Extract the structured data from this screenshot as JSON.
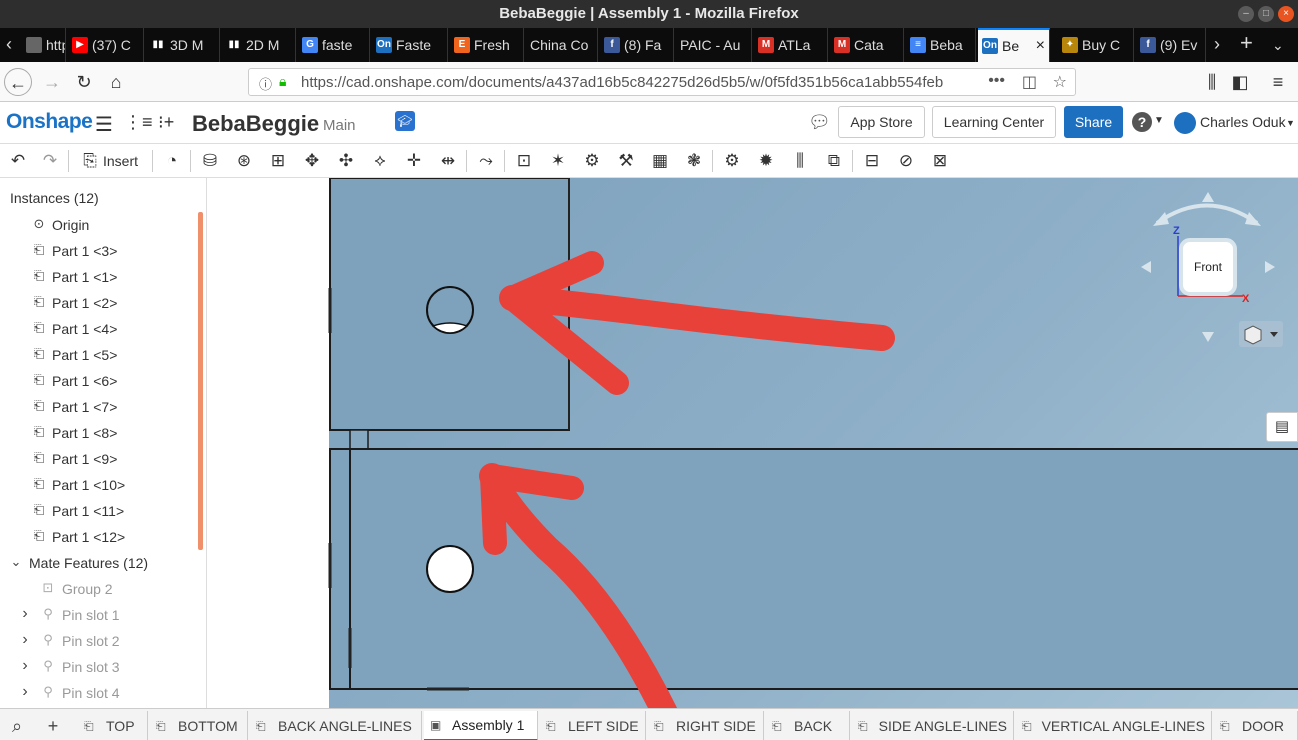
{
  "window": {
    "title": "BebaBeggie | Assembly 1 - Mozilla Firefox"
  },
  "browser_tabs": [
    {
      "label": "http",
      "favicon": "generic-page-icon",
      "fav_text": "",
      "fav_color": "#666666"
    },
    {
      "label": "(37) C",
      "favicon": "youtube-icon",
      "fav_text": "▶",
      "fav_color": "#ff0000"
    },
    {
      "label": "3D M",
      "favicon": "book-icon",
      "fav_text": "▮▮",
      "fav_color": "#0c0c0d"
    },
    {
      "label": "2D M",
      "favicon": "book-icon",
      "fav_text": "▮▮",
      "fav_color": "#0c0c0d"
    },
    {
      "label": "faste",
      "favicon": "google-icon",
      "fav_text": "G",
      "fav_color": "#4285f4"
    },
    {
      "label": "Faste",
      "favicon": "onshape-icon",
      "fav_text": "On",
      "fav_color": "#1d6fbf"
    },
    {
      "label": "Fresh",
      "favicon": "etsy-icon",
      "fav_text": "E",
      "fav_color": "#f1641e"
    },
    {
      "label": "China Co",
      "favicon": "none",
      "fav_text": "",
      "fav_color": "#0c0c0d"
    },
    {
      "label": "(8) Fa",
      "favicon": "facebook-icon",
      "fav_text": "f",
      "fav_color": "#3b5998"
    },
    {
      "label": "PAIC - Au",
      "favicon": "none",
      "fav_text": "",
      "fav_color": "#0c0c0d"
    },
    {
      "label": "ATLa",
      "favicon": "gmail-icon",
      "fav_text": "M",
      "fav_color": "#d93025"
    },
    {
      "label": "Cata",
      "favicon": "gmail-icon",
      "fav_text": "M",
      "fav_color": "#d93025"
    },
    {
      "label": "Beba",
      "favicon": "docs-icon",
      "fav_text": "≡",
      "fav_color": "#4285f4"
    },
    {
      "label": "Be",
      "favicon": "onshape-icon",
      "fav_text": "On",
      "fav_color": "#1d6fbf"
    },
    {
      "label": "Buy C",
      "favicon": "shop-icon",
      "fav_text": "✦",
      "fav_color": "#b8860b"
    },
    {
      "label": "(9) Ev",
      "favicon": "facebook-icon",
      "fav_text": "f",
      "fav_color": "#3b5998"
    }
  ],
  "nav": {
    "url": "https://cad.onshape.com/documents/a437ad16b5c842275d26d5b5/w/0f5fd351b56ca1abb554feb",
    "more": "•••"
  },
  "onshape": {
    "logo": "Onshape",
    "document_title": "BebaBeggie",
    "branch": "Main",
    "app_store": "App Store",
    "learning_center": "Learning Center",
    "share": "Share",
    "help": "?",
    "user_name": "Charles Oduk"
  },
  "toolbar": {
    "insert_label": "Insert"
  },
  "instances": {
    "header": "Instances (12)",
    "items": [
      {
        "label": "Origin",
        "icon": "origin-icon"
      },
      {
        "label": "Part 1 <3>",
        "icon": "part-icon"
      },
      {
        "label": "Part 1 <1>",
        "icon": "part-icon"
      },
      {
        "label": "Part 1 <2>",
        "icon": "part-icon"
      },
      {
        "label": "Part 1 <4>",
        "icon": "part-icon"
      },
      {
        "label": "Part 1 <5>",
        "icon": "part-icon"
      },
      {
        "label": "Part 1 <6>",
        "icon": "part-icon"
      },
      {
        "label": "Part 1 <7>",
        "icon": "part-icon"
      },
      {
        "label": "Part 1 <8>",
        "icon": "part-icon"
      },
      {
        "label": "Part 1 <9>",
        "icon": "part-icon"
      },
      {
        "label": "Part 1 <10>",
        "icon": "part-icon"
      },
      {
        "label": "Part 1 <11>",
        "icon": "part-icon"
      },
      {
        "label": "Part 1 <12>",
        "icon": "part-icon"
      }
    ],
    "mate_features": {
      "label": "Mate Features (12)",
      "items": [
        {
          "label": "Group 2",
          "icon": "group-icon"
        },
        {
          "label": "Pin slot 1",
          "icon": "pin-slot-icon"
        },
        {
          "label": "Pin slot 2",
          "icon": "pin-slot-icon"
        },
        {
          "label": "Pin slot 3",
          "icon": "pin-slot-icon"
        },
        {
          "label": "Pin slot 4",
          "icon": "pin-slot-icon"
        }
      ]
    }
  },
  "view_cube": {
    "face_label": "Front",
    "z_axis": "Z",
    "x_axis": "X"
  },
  "bottom_tabs": [
    {
      "label": "TOP",
      "active": false
    },
    {
      "label": "BOTTOM",
      "active": false
    },
    {
      "label": "BACK ANGLE-LINES",
      "active": false
    },
    {
      "label": "Assembly 1",
      "active": true
    },
    {
      "label": "LEFT SIDE",
      "active": false
    },
    {
      "label": "RIGHT SIDE",
      "active": false
    },
    {
      "label": "BACK",
      "active": false
    },
    {
      "label": "SIDE ANGLE-LINES",
      "active": false
    },
    {
      "label": "VERTICAL ANGLE-LINES",
      "active": false
    },
    {
      "label": "DOOR",
      "active": false
    }
  ],
  "colors": {
    "onshape_blue": "#1d6fbf",
    "annotation_red": "#e8413a",
    "viewport_blue": "#85a8c2",
    "tree_scrollbar": "#f0906a"
  }
}
